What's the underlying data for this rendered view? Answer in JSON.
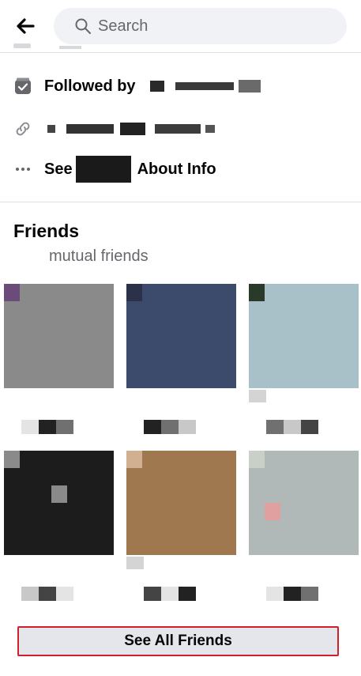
{
  "header": {
    "back_icon": "arrow-left-icon",
    "search_icon": "search-icon",
    "search_placeholder": "Search"
  },
  "intro": {
    "followed_by_label": "Followed by",
    "followed_icon": "check-badge-icon",
    "link_icon": "link-icon",
    "see_prefix": "See",
    "see_suffix": "About Info",
    "more_icon": "ellipsis-icon"
  },
  "friends": {
    "title": "Friends",
    "mutual_label": "mutual friends",
    "see_all_label": "See All Friends"
  },
  "colors": {
    "accent_border": "#d0202b",
    "button_bg": "#e4e6eb",
    "secondary_text": "#65676b"
  }
}
